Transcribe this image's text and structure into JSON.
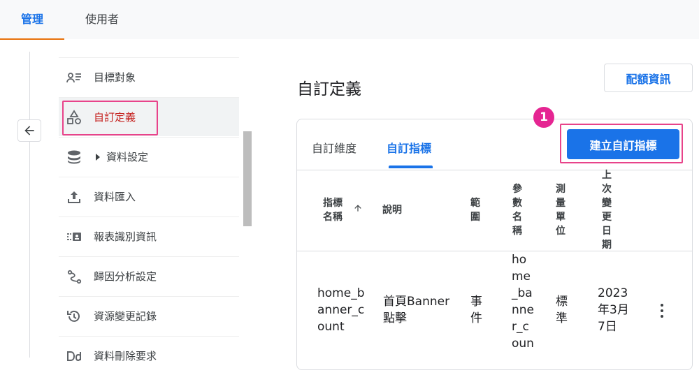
{
  "top_tabs": [
    {
      "label": "管理",
      "active": true
    },
    {
      "label": "使用者",
      "active": false
    }
  ],
  "sidebar": {
    "items": [
      {
        "label": "目標對象",
        "icon": "audience-icon"
      },
      {
        "label": "自訂定義",
        "icon": "shapes-icon",
        "selected": true
      },
      {
        "label": "資料設定",
        "icon": "database-icon",
        "expandable": true
      },
      {
        "label": "資料匯入",
        "icon": "upload-icon"
      },
      {
        "label": "報表識別資訊",
        "icon": "identity-icon"
      },
      {
        "label": "歸因分析設定",
        "icon": "attribution-icon"
      },
      {
        "label": "資源變更記錄",
        "icon": "history-icon"
      },
      {
        "label": "資料刪除要求",
        "icon": "data-deletion-icon"
      }
    ]
  },
  "main": {
    "title": "自訂定義",
    "quota_button": "配額資訊",
    "tabs": [
      {
        "label": "自訂維度",
        "active": false
      },
      {
        "label": "自訂指標",
        "active": true
      }
    ],
    "step_badge": "1",
    "create_button": "建立自訂指標"
  },
  "table": {
    "headers": {
      "name": [
        "指標",
        "名稱"
      ],
      "description": "說明",
      "scope": [
        "範",
        "圍"
      ],
      "param": [
        "參",
        "數",
        "名",
        "稱"
      ],
      "unit": [
        "測",
        "量",
        "單",
        "位"
      ],
      "updated": [
        "上",
        "次",
        "變",
        "更",
        "日",
        "期"
      ]
    },
    "row": {
      "name": [
        "home_b",
        "anner_c",
        "ount"
      ],
      "description": [
        "首頁Banner",
        "點擊"
      ],
      "scope": [
        "事",
        "件"
      ],
      "param": [
        "ho",
        "me",
        "_ba",
        "nne",
        "r_c",
        "oun"
      ],
      "unit": [
        "標",
        "準"
      ],
      "updated": [
        "2023",
        "年3月",
        "7日"
      ]
    }
  },
  "colors": {
    "accent": "#1a73e8",
    "highlight": "#e8438a",
    "badge": "#e52592",
    "top_tab_underline": "#e8710a",
    "selected_text": "#c5221f"
  }
}
